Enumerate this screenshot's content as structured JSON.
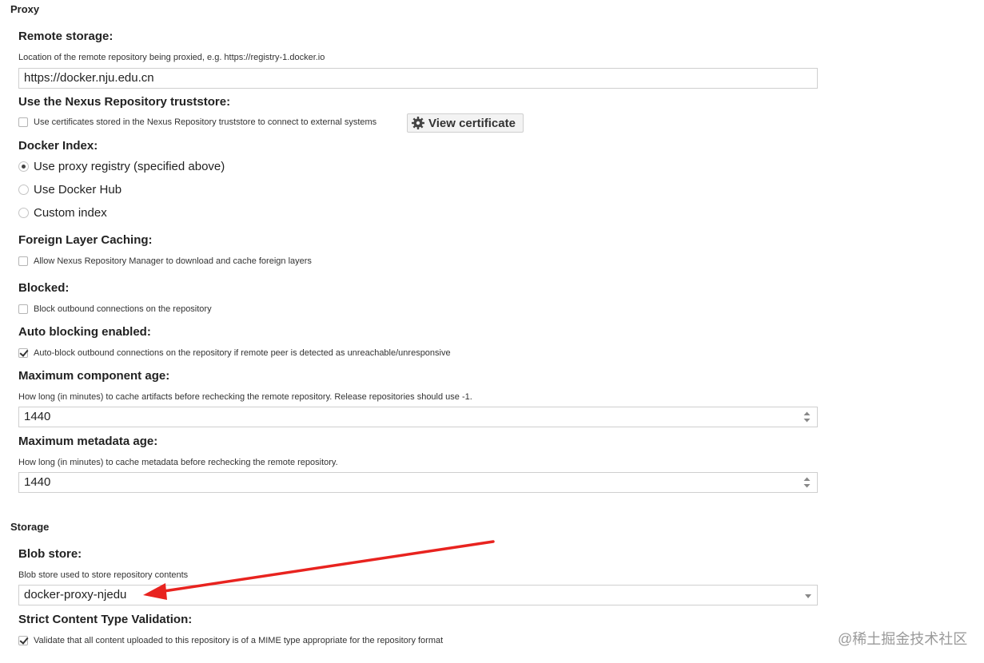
{
  "proxy": {
    "header": "Proxy",
    "remote_storage": {
      "label": "Remote storage:",
      "help": "Location of the remote repository being proxied, e.g. https://registry-1.docker.io",
      "value": "https://docker.nju.edu.cn"
    },
    "truststore": {
      "label": "Use the Nexus Repository truststore:",
      "checkbox_label": "Use certificates stored in the Nexus Repository truststore to connect to external systems",
      "checked": false,
      "button_label": "View certificate",
      "button_icon": "gear-icon"
    },
    "docker_index": {
      "label": "Docker Index:",
      "options": [
        "Use proxy registry (specified above)",
        "Use Docker Hub",
        "Custom index"
      ],
      "selected": "Use proxy registry (specified above)"
    },
    "foreign_layer": {
      "label": "Foreign Layer Caching:",
      "checkbox_label": "Allow Nexus Repository Manager to download and cache foreign layers",
      "checked": false
    },
    "blocked": {
      "label": "Blocked:",
      "checkbox_label": "Block outbound connections on the repository",
      "checked": false
    },
    "auto_blocking": {
      "label": "Auto blocking enabled:",
      "checkbox_label": "Auto-block outbound connections on the repository if remote peer is detected as unreachable/unresponsive",
      "checked": true
    },
    "max_component_age": {
      "label": "Maximum component age:",
      "help": "How long (in minutes) to cache artifacts before rechecking the remote repository. Release repositories should use -1.",
      "value": "1440"
    },
    "max_metadata_age": {
      "label": "Maximum metadata age:",
      "help": "How long (in minutes) to cache metadata before rechecking the remote repository.",
      "value": "1440"
    }
  },
  "storage": {
    "header": "Storage",
    "blob_store": {
      "label": "Blob store:",
      "help": "Blob store used to store repository contents",
      "value": "docker-proxy-njedu"
    },
    "strict_validation": {
      "label": "Strict Content Type Validation:",
      "checkbox_label": "Validate that all content uploaded to this repository is of a MIME type appropriate for the repository format",
      "checked": true
    }
  },
  "annotation": {
    "arrow_color": "#e8231f"
  },
  "watermark": "@稀土掘金技术社区"
}
